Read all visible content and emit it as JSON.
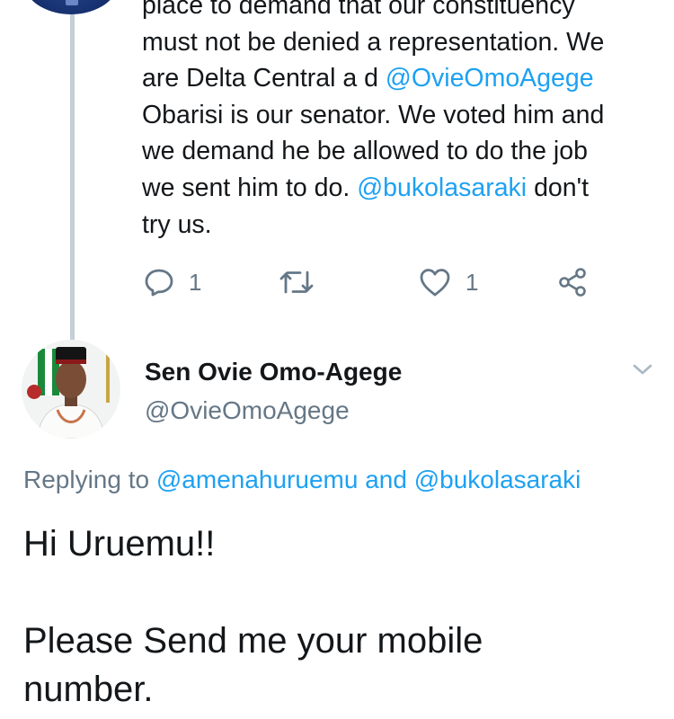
{
  "previous_tweet": {
    "lines": [
      [
        {
          "t": "place to demand that our constituency",
          "m": false
        }
      ],
      [
        {
          "t": "must not be denied a representation. We",
          "m": false
        }
      ],
      [
        {
          "t": "are Delta Central a d ",
          "m": false
        },
        {
          "t": "@OvieOmoAgege",
          "m": true
        }
      ],
      [
        {
          "t": "Obarisi is our senator. We voted him and",
          "m": false
        }
      ],
      [
        {
          "t": "we demand he be allowed to do the job",
          "m": false
        }
      ],
      [
        {
          "t": "we sent him to do. ",
          "m": false
        },
        {
          "t": "@bukolasaraki",
          "m": true
        },
        {
          "t": " don't",
          "m": false
        }
      ],
      [
        {
          "t": "try us.",
          "m": false
        }
      ]
    ],
    "reply_count": "1",
    "like_count": "1",
    "icons": [
      "reply-icon",
      "retweet-icon",
      "heart-icon",
      "share-icon"
    ]
  },
  "reply_tweet": {
    "display_name": "Sen Ovie Omo-Agege",
    "handle": "@OvieOmoAgege",
    "replying_prefix": "Replying to ",
    "replying_mention_1": "@amenahuruemu",
    "replying_and": " and ",
    "replying_mention_2": "@bukolasaraki",
    "body_lines": [
      "Hi Uruemu!!",
      "",
      "Please Send me your mobile",
      "number."
    ]
  },
  "colors": {
    "mention": "#1da1f2",
    "secondary": "#657786",
    "thread_line": "#c4cfd6",
    "text": "#14171a"
  }
}
